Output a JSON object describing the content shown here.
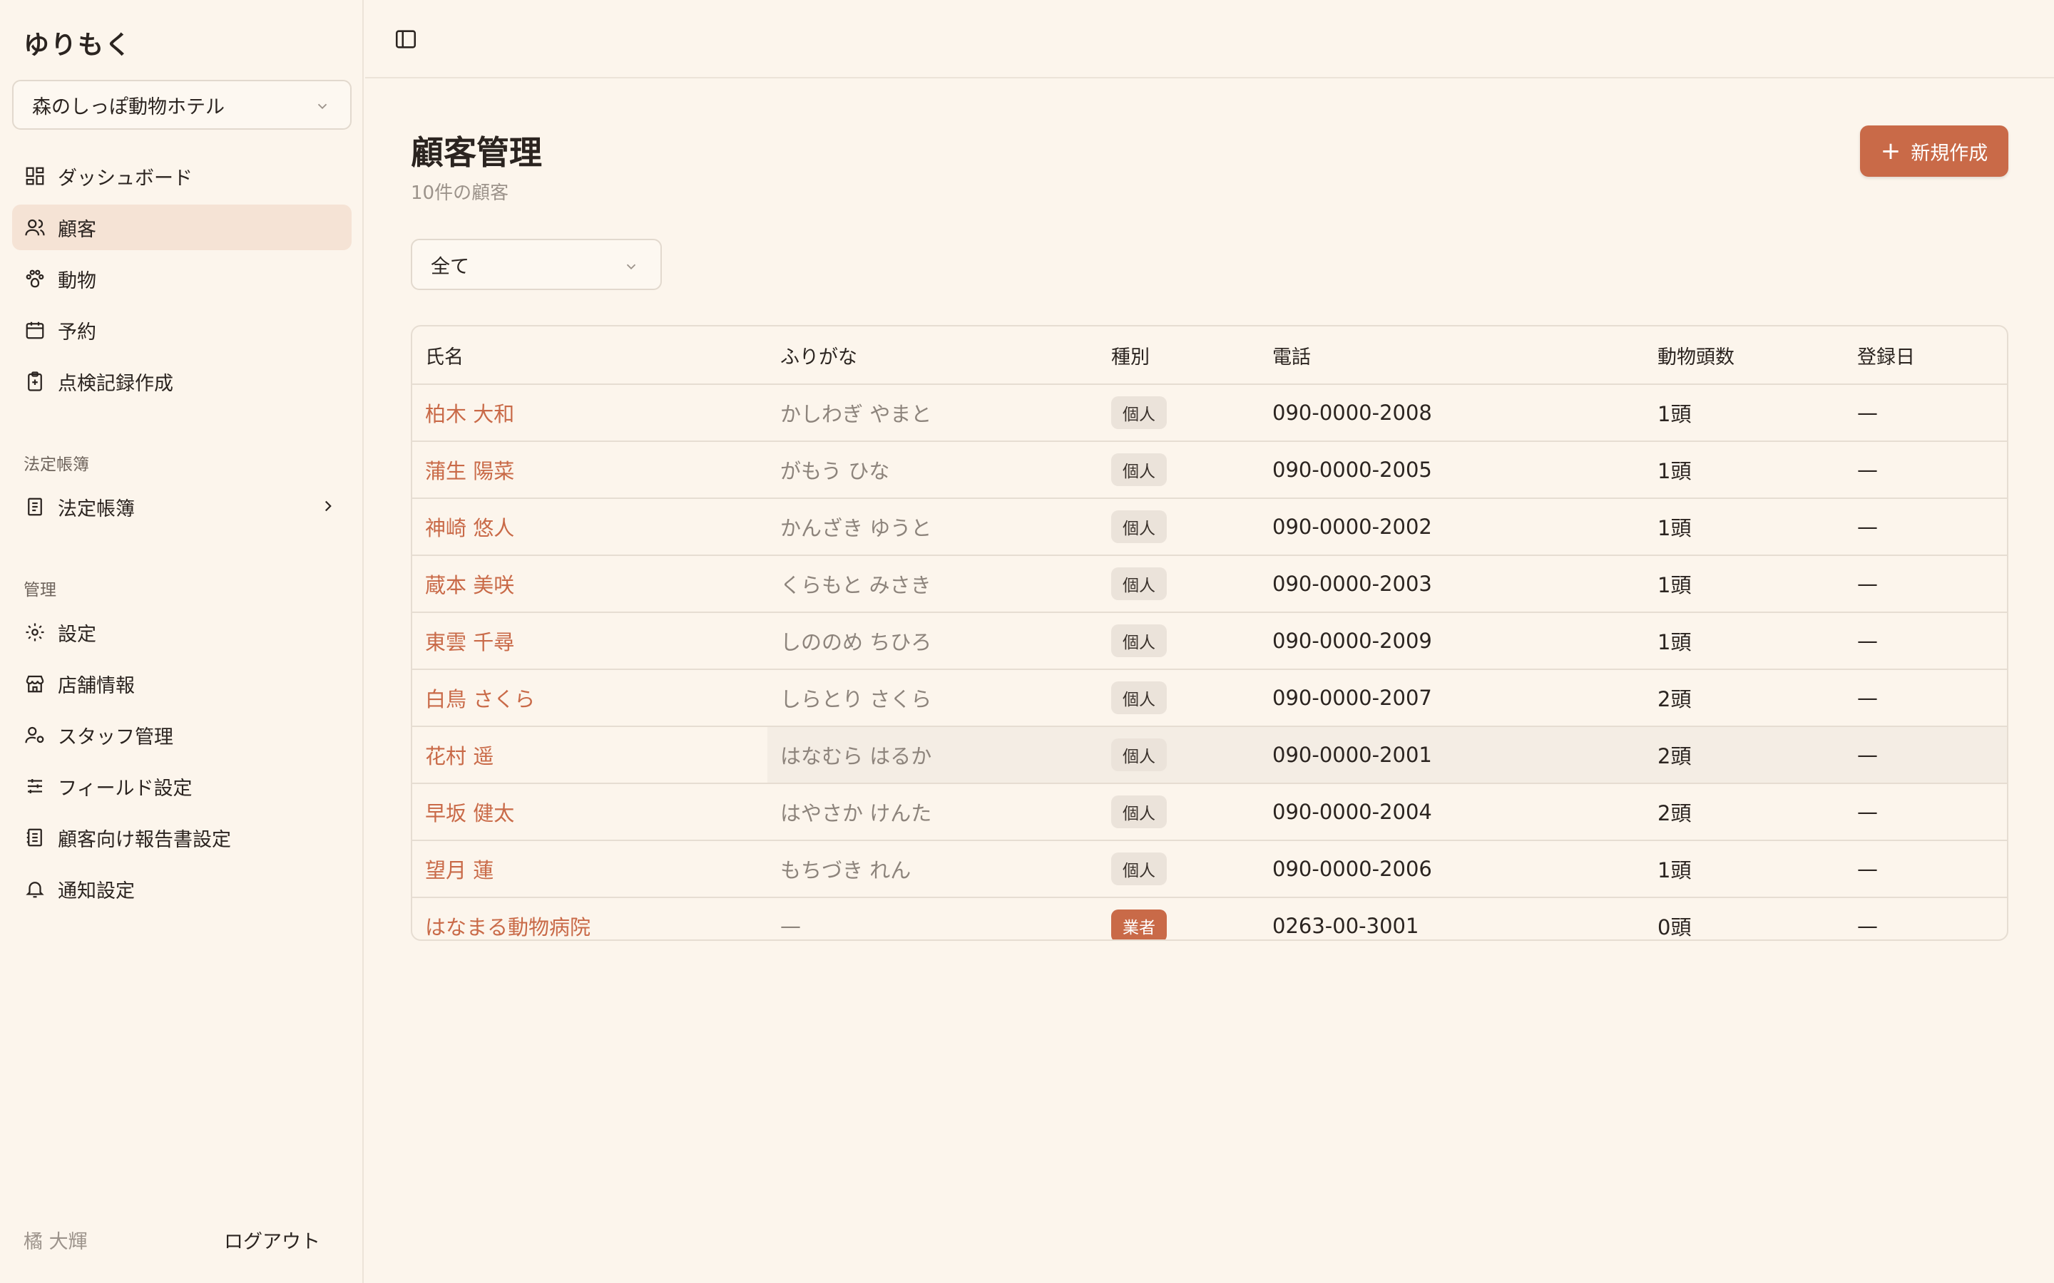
{
  "app": {
    "brand": "ゆりもく"
  },
  "sidebar": {
    "store_select": "森のしっぽ動物ホテル",
    "main_items": [
      {
        "label": "ダッシュボード",
        "icon": "dashboard-icon"
      },
      {
        "label": "顧客",
        "icon": "users-icon",
        "active": true
      },
      {
        "label": "動物",
        "icon": "paw-icon"
      },
      {
        "label": "予約",
        "icon": "calendar-icon"
      },
      {
        "label": "点検記録作成",
        "icon": "clipboard-icon"
      }
    ],
    "ledger_section": "法定帳簿",
    "ledger_item": "法定帳簿",
    "admin_section": "管理",
    "admin_items": [
      {
        "label": "設定",
        "icon": "gear-icon"
      },
      {
        "label": "店舗情報",
        "icon": "store-icon"
      },
      {
        "label": "スタッフ管理",
        "icon": "user-settings-icon"
      },
      {
        "label": "フィールド設定",
        "icon": "sliders-icon"
      },
      {
        "label": "顧客向け報告書設定",
        "icon": "report-icon"
      },
      {
        "label": "通知設定",
        "icon": "bell-icon"
      }
    ],
    "user_name": "橘 大輝",
    "logout_label": "ログアウト"
  },
  "main": {
    "title": "顧客管理",
    "subtitle": "10件の顧客",
    "new_button": "新規作成",
    "filter_value": "全て",
    "columns": [
      "氏名",
      "ふりがな",
      "種別",
      "電話",
      "動物頭数",
      "登録日"
    ],
    "rows": [
      {
        "name": "柏木 大和",
        "kana": "かしわぎ やまと",
        "type": "個人",
        "phone": "090-0000-2008",
        "count": "1頭",
        "date": "—"
      },
      {
        "name": "蒲生 陽菜",
        "kana": "がもう ひな",
        "type": "個人",
        "phone": "090-0000-2005",
        "count": "1頭",
        "date": "—"
      },
      {
        "name": "神崎 悠人",
        "kana": "かんざき ゆうと",
        "type": "個人",
        "phone": "090-0000-2002",
        "count": "1頭",
        "date": "—"
      },
      {
        "name": "蔵本 美咲",
        "kana": "くらもと みさき",
        "type": "個人",
        "phone": "090-0000-2003",
        "count": "1頭",
        "date": "—"
      },
      {
        "name": "東雲 千尋",
        "kana": "しののめ ちひろ",
        "type": "個人",
        "phone": "090-0000-2009",
        "count": "1頭",
        "date": "—"
      },
      {
        "name": "白鳥 さくら",
        "kana": "しらとり さくら",
        "type": "個人",
        "phone": "090-0000-2007",
        "count": "2頭",
        "date": "—"
      },
      {
        "name": "花村 遥",
        "kana": "はなむら はるか",
        "type": "個人",
        "phone": "090-0000-2001",
        "count": "2頭",
        "date": "—"
      },
      {
        "name": "早坂 健太",
        "kana": "はやさか けんた",
        "type": "個人",
        "phone": "090-0000-2004",
        "count": "2頭",
        "date": "—"
      },
      {
        "name": "望月 蓮",
        "kana": "もちづき れん",
        "type": "個人",
        "phone": "090-0000-2006",
        "count": "1頭",
        "date": "—"
      },
      {
        "name": "はなまる動物病院",
        "kana": "—",
        "type": "業者",
        "phone": "0263-00-3001",
        "count": "0頭",
        "date": "—"
      }
    ]
  },
  "colors": {
    "accent": "#c96a48",
    "background": "#fcf5ec",
    "active_nav": "#f5e3d5"
  }
}
